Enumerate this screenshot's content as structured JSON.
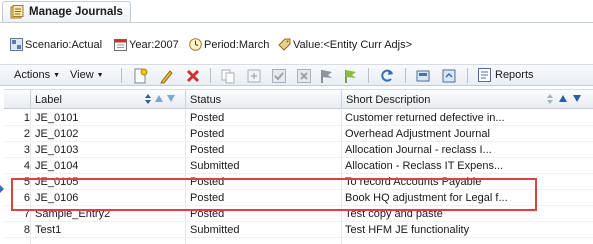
{
  "tab": {
    "title": "Manage Journals",
    "icon": "journals-icon"
  },
  "pov": {
    "scenario": "Scenario:Actual",
    "year": "Year:2007",
    "period": "Period:March",
    "value": "Value:<Entity Curr Adjs>"
  },
  "toolbar": {
    "actions_label": "Actions",
    "view_label": "View",
    "reports_label": "Reports"
  },
  "columns": {
    "label": "Label",
    "status": "Status",
    "short_description": "Short Description"
  },
  "rows": [
    {
      "num": "1",
      "label": "JE_0101",
      "status": "Posted",
      "desc": "Customer returned defective in..."
    },
    {
      "num": "2",
      "label": "JE_0102",
      "status": "Posted",
      "desc": "Overhead Adjustment Journal"
    },
    {
      "num": "3",
      "label": "JE_0103",
      "status": "Posted",
      "desc": "Allocation Journal - reclass I..."
    },
    {
      "num": "4",
      "label": "JE_0104",
      "status": "Submitted",
      "desc": "Allocation - Reclass IT Expens..."
    },
    {
      "num": "5",
      "label": "JE_0105",
      "status": "Posted",
      "desc": "To record Accounts Payable"
    },
    {
      "num": "6",
      "label": "JE_0106",
      "status": "Posted",
      "desc": "Book HQ adjustment for Legal f..."
    },
    {
      "num": "7",
      "label": "Sample_Entry2",
      "status": "Posted",
      "desc": "Test copy and paste"
    },
    {
      "num": "8",
      "label": "Test1",
      "status": "Submitted",
      "desc": "Test HFM JE functionality"
    }
  ],
  "colors": {
    "highlight_border": "#d64541",
    "accent": "#3a6fb0"
  }
}
